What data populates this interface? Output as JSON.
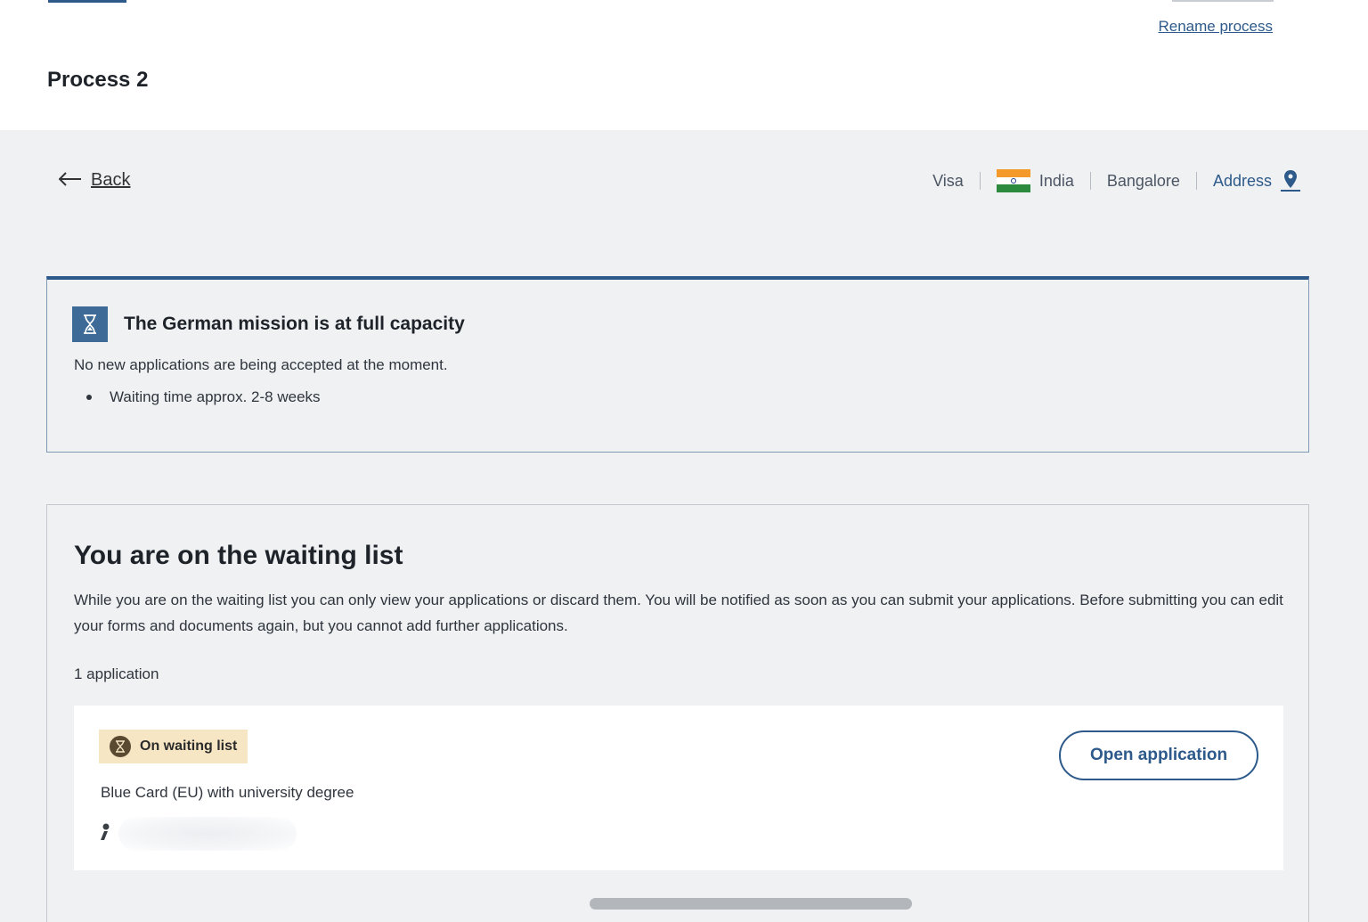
{
  "header": {
    "rename_label": "Rename process",
    "title": "Process 2"
  },
  "nav": {
    "back_label": "Back",
    "back_icon": "arrow-left-icon",
    "crumbs": {
      "category": "Visa",
      "country": "India",
      "city": "Bangalore",
      "address": "Address",
      "address_icon": "map-pin-icon"
    }
  },
  "notice": {
    "icon": "hourglass-icon",
    "title": "The German mission is at full capacity",
    "text": "No new applications are being accepted at the moment.",
    "bullet": "Waiting time approx. 2-8 weeks"
  },
  "waiting": {
    "title": "You are on the waiting list",
    "description": "While you are on the waiting list you can only view your applications or discard them. You will be notified as soon as you can submit your applications. Before submitting you can edit your forms and documents again, but you cannot add further applications.",
    "count": "1 application",
    "application": {
      "status": "On waiting list",
      "status_icon": "hourglass-icon",
      "name": "Blue Card (EU) with university degree",
      "person_icon": "person-icon",
      "open_label": "Open application"
    }
  },
  "colors": {
    "accent": "#2d5a8a",
    "background": "#f0f1f3",
    "badge_bg": "#f7e6c4"
  }
}
